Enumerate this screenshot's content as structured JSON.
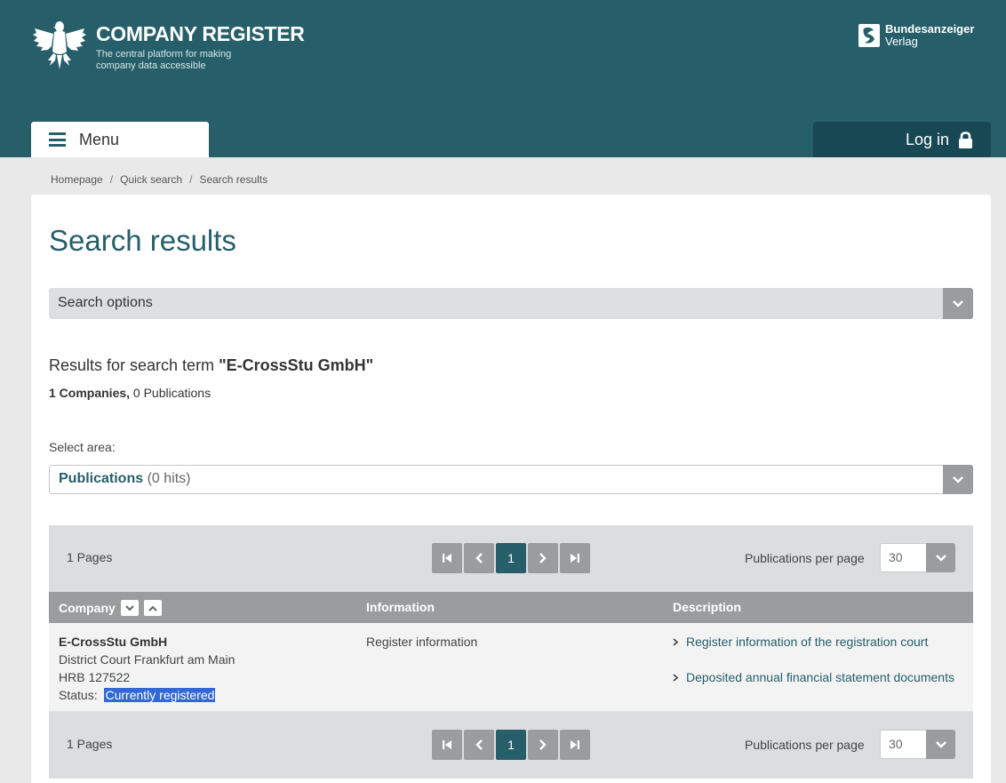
{
  "header": {
    "brand_title": "COMPANY REGISTER",
    "brand_subtitle": "The central platform for making company data accessible",
    "publisher_line1": "Bundesanzeiger",
    "publisher_line2": "Verlag",
    "menu_label": "Menu",
    "login_label": "Log in",
    "icons": {
      "logo": "eagle-logo-icon",
      "publisher": "bundesanzeiger-logo-icon",
      "menu": "hamburger-icon",
      "login": "lock-icon"
    }
  },
  "breadcrumb": {
    "items": [
      "Homepage",
      "Quick search",
      "Search results"
    ],
    "separator": "/"
  },
  "page": {
    "title": "Search results",
    "search_options_label": "Search options",
    "results_prefix": "Results for search term ",
    "search_term": "\"E-CrossStu GmbH\"",
    "companies_count": "1 Companies,",
    "publications_count": "0 Publications",
    "select_area_label": "Select area:",
    "area_value": "Publications",
    "area_hits": "(0 hits)"
  },
  "pagination": {
    "pages_text": "1 Pages",
    "current_page": "1",
    "per_page_label": "Publications per page",
    "per_page_value": "30"
  },
  "table": {
    "headers": [
      "Company",
      "Information",
      "Description"
    ],
    "rows": [
      {
        "company_name": "E-CrossStu GmbH",
        "court": "District Court Frankfurt am Main",
        "register_no": "HRB 127522",
        "status_label": "Status:",
        "status_value": "Currently registered",
        "information": "Register information",
        "descriptions": [
          "Register information of the registration court",
          "Deposited annual financial statement documents"
        ]
      }
    ]
  },
  "colors": {
    "header_bg": "#265f6a",
    "login_bg": "#174854",
    "accent": "#265f6a",
    "gray_button": "#9a9c9e",
    "highlight": "#3367d6"
  }
}
